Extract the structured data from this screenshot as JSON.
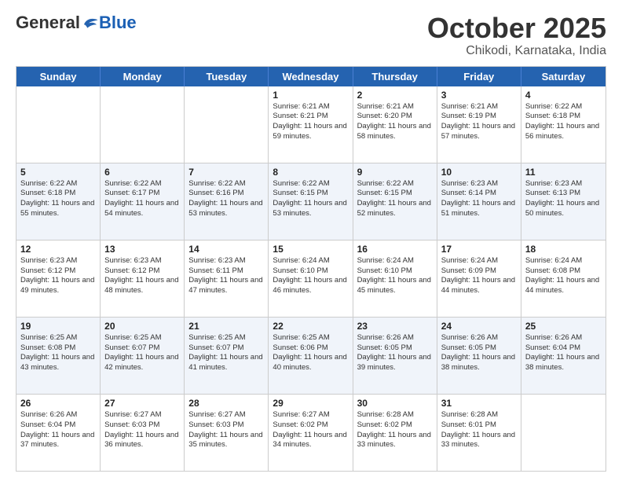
{
  "logo": {
    "general": "General",
    "blue": "Blue"
  },
  "title": "October 2025",
  "location": "Chikodi, Karnataka, India",
  "days_of_week": [
    "Sunday",
    "Monday",
    "Tuesday",
    "Wednesday",
    "Thursday",
    "Friday",
    "Saturday"
  ],
  "weeks": [
    {
      "alt": false,
      "cells": [
        {
          "day": "",
          "content": ""
        },
        {
          "day": "",
          "content": ""
        },
        {
          "day": "",
          "content": ""
        },
        {
          "day": "1",
          "content": "Sunrise: 6:21 AM\nSunset: 6:21 PM\nDaylight: 11 hours and 59 minutes."
        },
        {
          "day": "2",
          "content": "Sunrise: 6:21 AM\nSunset: 6:20 PM\nDaylight: 11 hours and 58 minutes."
        },
        {
          "day": "3",
          "content": "Sunrise: 6:21 AM\nSunset: 6:19 PM\nDaylight: 11 hours and 57 minutes."
        },
        {
          "day": "4",
          "content": "Sunrise: 6:22 AM\nSunset: 6:18 PM\nDaylight: 11 hours and 56 minutes."
        }
      ]
    },
    {
      "alt": true,
      "cells": [
        {
          "day": "5",
          "content": "Sunrise: 6:22 AM\nSunset: 6:18 PM\nDaylight: 11 hours and 55 minutes."
        },
        {
          "day": "6",
          "content": "Sunrise: 6:22 AM\nSunset: 6:17 PM\nDaylight: 11 hours and 54 minutes."
        },
        {
          "day": "7",
          "content": "Sunrise: 6:22 AM\nSunset: 6:16 PM\nDaylight: 11 hours and 53 minutes."
        },
        {
          "day": "8",
          "content": "Sunrise: 6:22 AM\nSunset: 6:15 PM\nDaylight: 11 hours and 53 minutes."
        },
        {
          "day": "9",
          "content": "Sunrise: 6:22 AM\nSunset: 6:15 PM\nDaylight: 11 hours and 52 minutes."
        },
        {
          "day": "10",
          "content": "Sunrise: 6:23 AM\nSunset: 6:14 PM\nDaylight: 11 hours and 51 minutes."
        },
        {
          "day": "11",
          "content": "Sunrise: 6:23 AM\nSunset: 6:13 PM\nDaylight: 11 hours and 50 minutes."
        }
      ]
    },
    {
      "alt": false,
      "cells": [
        {
          "day": "12",
          "content": "Sunrise: 6:23 AM\nSunset: 6:12 PM\nDaylight: 11 hours and 49 minutes."
        },
        {
          "day": "13",
          "content": "Sunrise: 6:23 AM\nSunset: 6:12 PM\nDaylight: 11 hours and 48 minutes."
        },
        {
          "day": "14",
          "content": "Sunrise: 6:23 AM\nSunset: 6:11 PM\nDaylight: 11 hours and 47 minutes."
        },
        {
          "day": "15",
          "content": "Sunrise: 6:24 AM\nSunset: 6:10 PM\nDaylight: 11 hours and 46 minutes."
        },
        {
          "day": "16",
          "content": "Sunrise: 6:24 AM\nSunset: 6:10 PM\nDaylight: 11 hours and 45 minutes."
        },
        {
          "day": "17",
          "content": "Sunrise: 6:24 AM\nSunset: 6:09 PM\nDaylight: 11 hours and 44 minutes."
        },
        {
          "day": "18",
          "content": "Sunrise: 6:24 AM\nSunset: 6:08 PM\nDaylight: 11 hours and 44 minutes."
        }
      ]
    },
    {
      "alt": true,
      "cells": [
        {
          "day": "19",
          "content": "Sunrise: 6:25 AM\nSunset: 6:08 PM\nDaylight: 11 hours and 43 minutes."
        },
        {
          "day": "20",
          "content": "Sunrise: 6:25 AM\nSunset: 6:07 PM\nDaylight: 11 hours and 42 minutes."
        },
        {
          "day": "21",
          "content": "Sunrise: 6:25 AM\nSunset: 6:07 PM\nDaylight: 11 hours and 41 minutes."
        },
        {
          "day": "22",
          "content": "Sunrise: 6:25 AM\nSunset: 6:06 PM\nDaylight: 11 hours and 40 minutes."
        },
        {
          "day": "23",
          "content": "Sunrise: 6:26 AM\nSunset: 6:05 PM\nDaylight: 11 hours and 39 minutes."
        },
        {
          "day": "24",
          "content": "Sunrise: 6:26 AM\nSunset: 6:05 PM\nDaylight: 11 hours and 38 minutes."
        },
        {
          "day": "25",
          "content": "Sunrise: 6:26 AM\nSunset: 6:04 PM\nDaylight: 11 hours and 38 minutes."
        }
      ]
    },
    {
      "alt": false,
      "cells": [
        {
          "day": "26",
          "content": "Sunrise: 6:26 AM\nSunset: 6:04 PM\nDaylight: 11 hours and 37 minutes."
        },
        {
          "day": "27",
          "content": "Sunrise: 6:27 AM\nSunset: 6:03 PM\nDaylight: 11 hours and 36 minutes."
        },
        {
          "day": "28",
          "content": "Sunrise: 6:27 AM\nSunset: 6:03 PM\nDaylight: 11 hours and 35 minutes."
        },
        {
          "day": "29",
          "content": "Sunrise: 6:27 AM\nSunset: 6:02 PM\nDaylight: 11 hours and 34 minutes."
        },
        {
          "day": "30",
          "content": "Sunrise: 6:28 AM\nSunset: 6:02 PM\nDaylight: 11 hours and 33 minutes."
        },
        {
          "day": "31",
          "content": "Sunrise: 6:28 AM\nSunset: 6:01 PM\nDaylight: 11 hours and 33 minutes."
        },
        {
          "day": "",
          "content": ""
        }
      ]
    }
  ]
}
